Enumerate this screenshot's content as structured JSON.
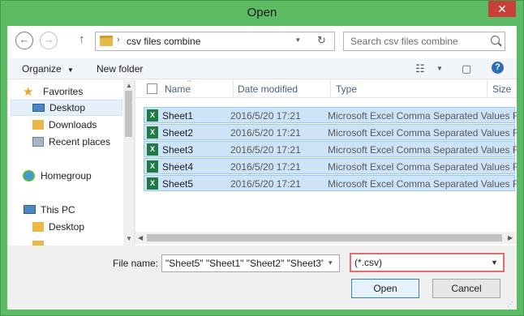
{
  "window": {
    "title": "Open",
    "close_glyph": "✕"
  },
  "address": {
    "back_glyph": "←",
    "forward_glyph": "→",
    "up_glyph": "↑",
    "separator": "›",
    "path": "csv files combine",
    "dropdown_glyph": "▾",
    "refresh_glyph": "↻"
  },
  "search": {
    "placeholder": "Search csv files combine"
  },
  "toolbar": {
    "organize_label": "Organize",
    "organize_arrow": "▼",
    "new_folder_label": "New folder",
    "view_glyph": "☷",
    "view_arrow": "▼",
    "pane_glyph": "▢",
    "help_glyph": "?"
  },
  "sidebar": {
    "items": [
      {
        "label": "Favorites",
        "icon": "star-icon"
      },
      {
        "label": "Desktop",
        "icon": "desktop-icon",
        "selected": true
      },
      {
        "label": "Downloads",
        "icon": "downloads-folder-icon"
      },
      {
        "label": "Recent places",
        "icon": "recent-places-icon"
      },
      {
        "label": "Homegroup",
        "icon": "homegroup-icon"
      },
      {
        "label": "This PC",
        "icon": "computer-icon"
      },
      {
        "label": "Desktop",
        "icon": "desktop-folder-icon"
      }
    ],
    "scroll_up": "▲",
    "scroll_down": "▼"
  },
  "columns": {
    "name": "Name",
    "date": "Date modified",
    "type": "Type",
    "size": "Size",
    "sort_glyph": "^"
  },
  "files": [
    {
      "name": "Sheet1",
      "date": "2016/5/20 17:21",
      "type": "Microsoft Excel Comma Separated Values File"
    },
    {
      "name": "Sheet2",
      "date": "2016/5/20 17:21",
      "type": "Microsoft Excel Comma Separated Values File"
    },
    {
      "name": "Sheet3",
      "date": "2016/5/20 17:21",
      "type": "Microsoft Excel Comma Separated Values File"
    },
    {
      "name": "Sheet4",
      "date": "2016/5/20 17:21",
      "type": "Microsoft Excel Comma Separated Values File"
    },
    {
      "name": "Sheet5",
      "date": "2016/5/20 17:21",
      "type": "Microsoft Excel Comma Separated Values File"
    }
  ],
  "file_icon_letter": "X",
  "hscroll": {
    "left": "◀",
    "right": "▶"
  },
  "bottom": {
    "filename_label": "File name:",
    "filename_value": "\"Sheet5\" \"Sheet1\" \"Sheet2\" \"Sheet3\" \"",
    "filename_dd": "▾",
    "filter_value": "(*.csv)",
    "filter_dd": "▼",
    "open_label": "Open",
    "cancel_label": "Cancel",
    "grip": "⋰"
  },
  "colors": {
    "title_bar": "#5dbb63",
    "selection": "#cce3f8",
    "filter_highlight": "#e46c6c",
    "close": "#c7403a"
  }
}
